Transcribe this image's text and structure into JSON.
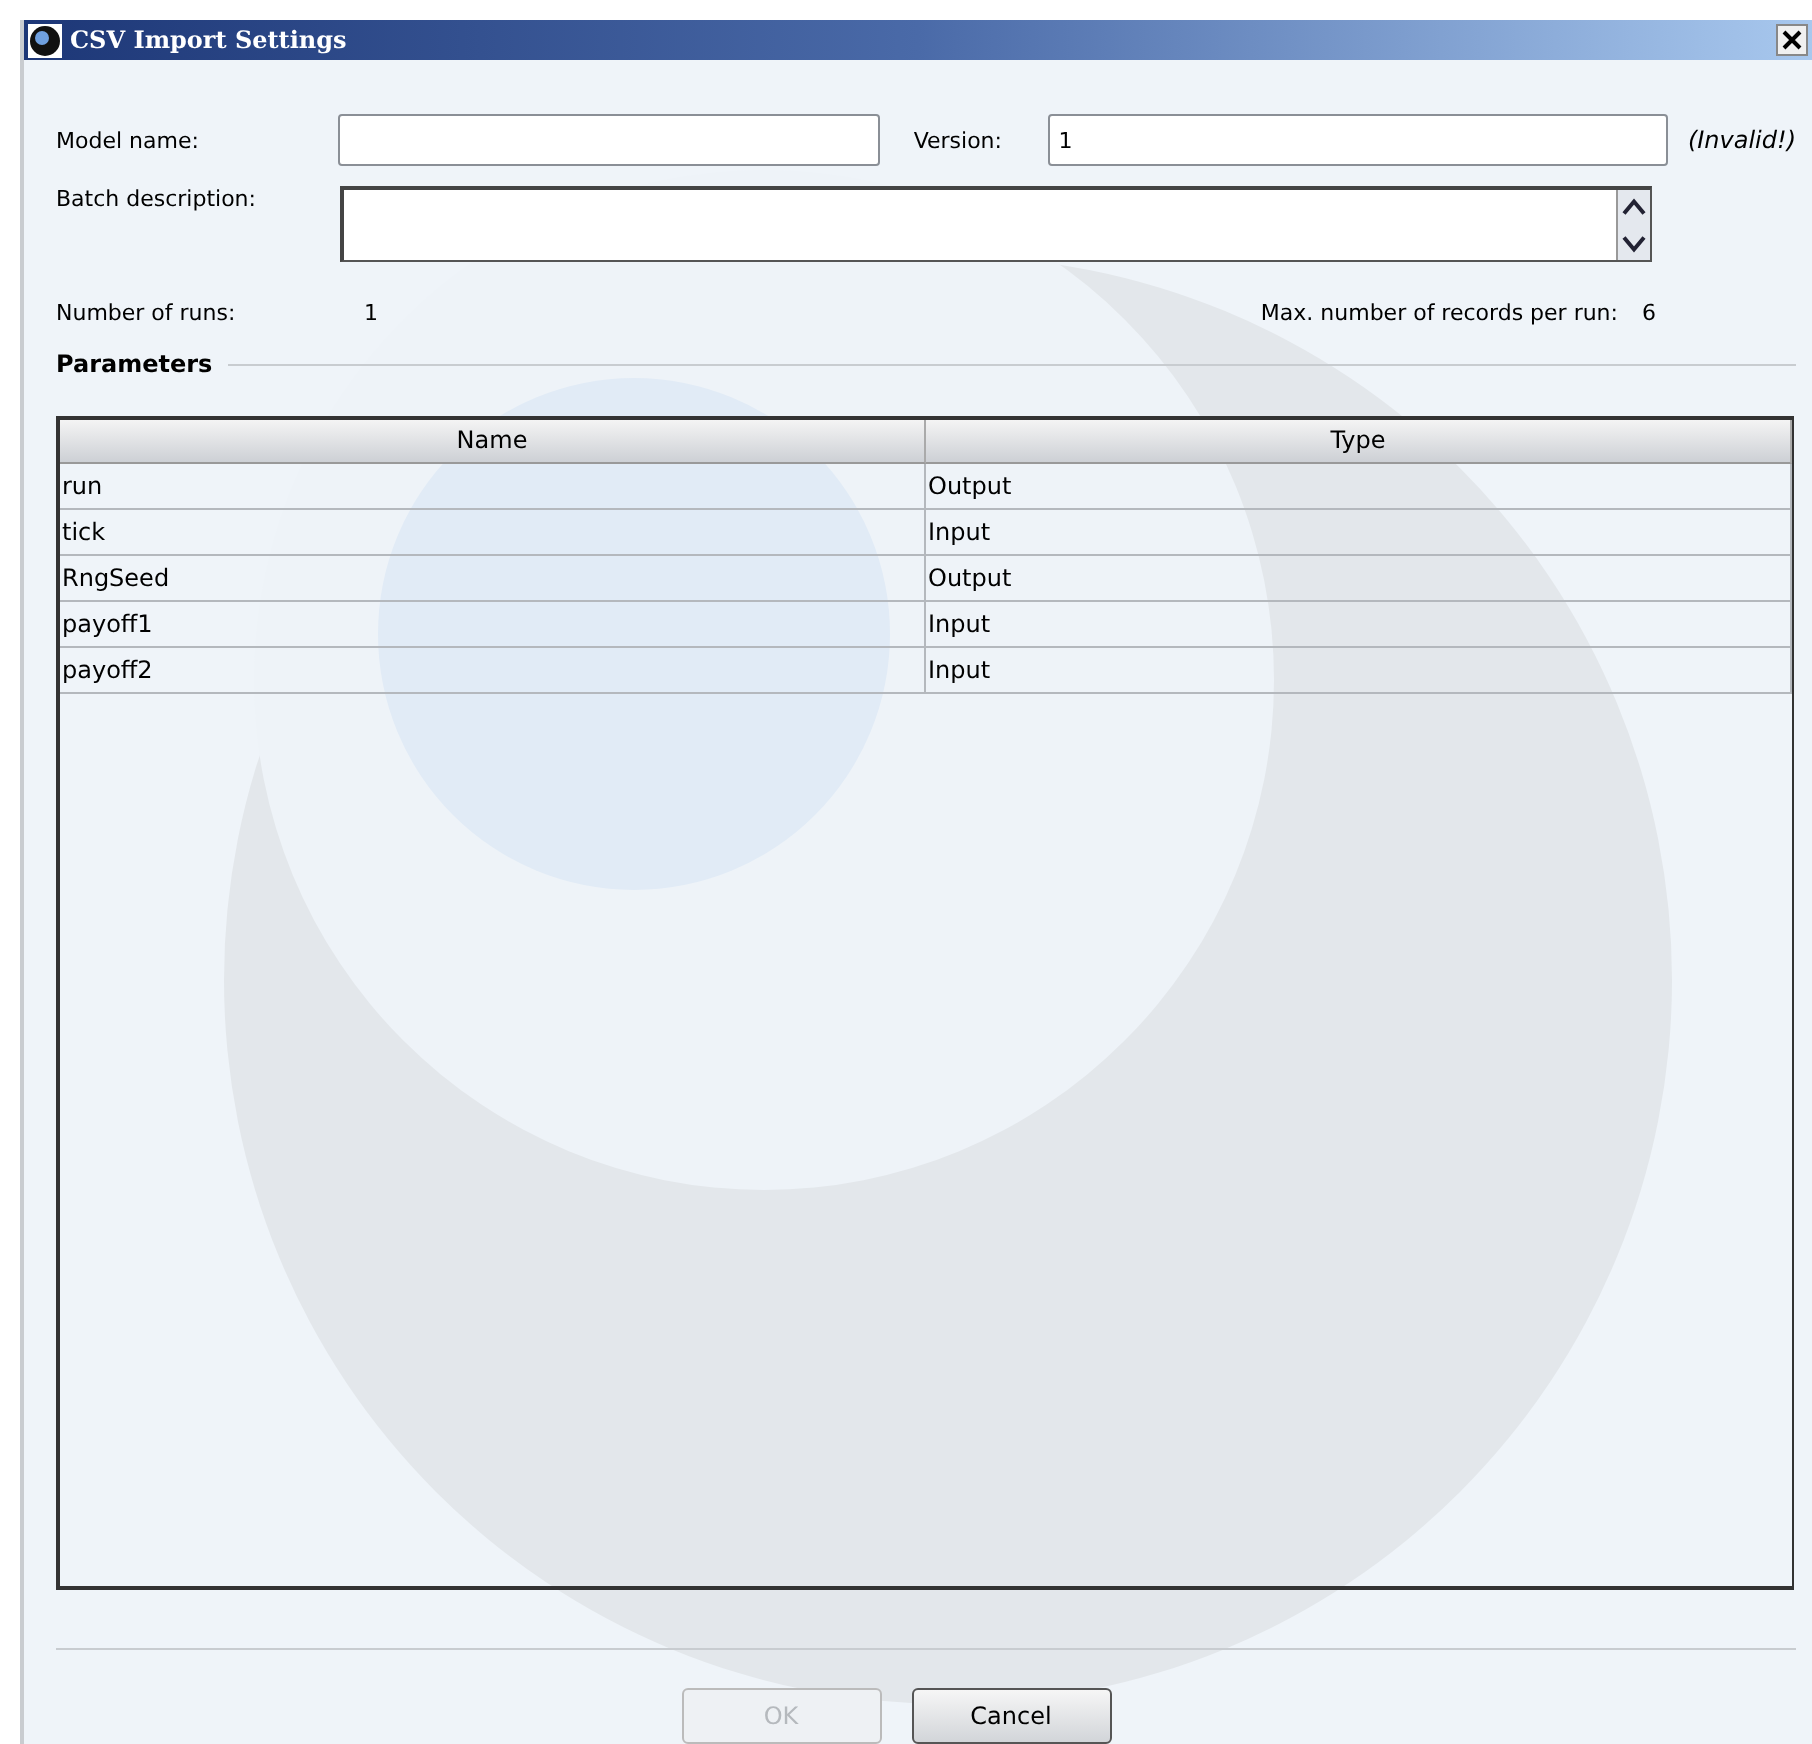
{
  "window": {
    "title": "CSV Import Settings"
  },
  "model_name": {
    "label": "Model name:"
  },
  "version": {
    "label": "Version:",
    "value": "1",
    "status": "(Invalid!)"
  },
  "batch_description": {
    "label": "Batch description:"
  },
  "number_of_runs": {
    "label": "Number of runs:",
    "value": "1"
  },
  "max_records": {
    "label": "Max. number of records per run:",
    "value": "6"
  },
  "parameters": {
    "title": "Parameters",
    "columns": [
      "Name",
      "Type"
    ],
    "rows": [
      {
        "name": "run",
        "type": "Output"
      },
      {
        "name": "tick",
        "type": "Input"
      },
      {
        "name": "RngSeed",
        "type": "Output"
      },
      {
        "name": "payoff1",
        "type": "Input"
      },
      {
        "name": "payoff2",
        "type": "Input"
      }
    ]
  },
  "buttons": [
    {
      "label": "OK",
      "disabled": true
    },
    {
      "label": "Cancel",
      "disabled": false
    }
  ]
}
